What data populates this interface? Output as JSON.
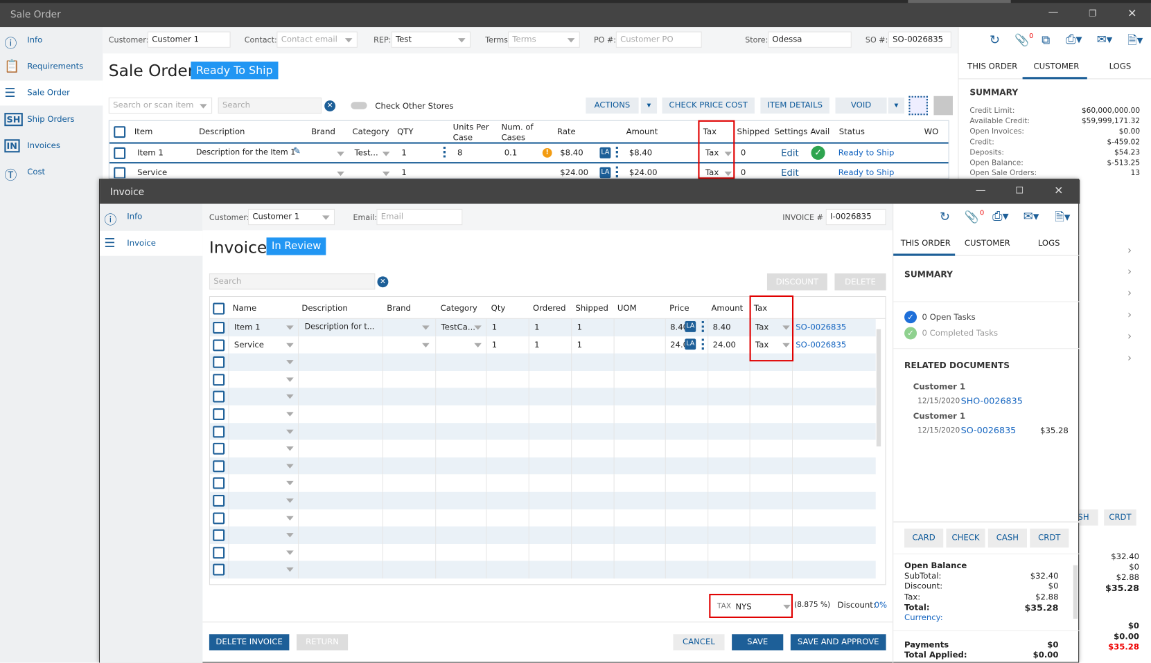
{
  "sale_order": {
    "window_title": "Sale Order",
    "sidebar": [
      {
        "label": "Info",
        "icon": "info-icon"
      },
      {
        "label": "Requirements",
        "icon": "clipboard-icon"
      },
      {
        "label": "Sale Order",
        "icon": "list-icon"
      },
      {
        "label": "Ship Orders",
        "icon": "ship-orders-icon"
      },
      {
        "label": "Invoices",
        "icon": "invoice-icon"
      },
      {
        "label": "Cost",
        "icon": "dollar-icon"
      }
    ],
    "header": {
      "customer_label": "Customer:",
      "customer": "Customer 1",
      "contact_label": "Contact:",
      "contact_placeholder": "Contact email",
      "rep_label": "REP:",
      "rep": "Test",
      "terms_label": "Terms:",
      "terms_placeholder": "Terms",
      "po_label": "PO #:",
      "po_placeholder": "Customer PO",
      "store_label": "Store:",
      "store": "Odessa",
      "so_label": "SO #:",
      "so": "SO-0026835"
    },
    "title": "Sale Order",
    "status": "Ready To Ship",
    "toolbar": {
      "search_item_placeholder": "Search or scan item",
      "search_placeholder": "Search",
      "check_other_stores": "Check Other Stores",
      "actions": "ACTIONS",
      "check_price_cost": "CHECK PRICE COST",
      "item_details": "ITEM DETAILS",
      "void": "VOID"
    },
    "columns": [
      "Item",
      "Description",
      "Brand",
      "Category",
      "QTY",
      "Units Per Case",
      "Num. of Cases",
      "Rate",
      "Amount",
      "Tax",
      "Shipped",
      "Settings",
      "Avail",
      "Status",
      "WO"
    ],
    "rows": [
      {
        "item": "Item 1",
        "description": "Description for the Item 1",
        "category": "Test...",
        "qty": "1",
        "units": "8",
        "cases": "0.1",
        "rate": "$8.40",
        "la": "LA",
        "amount": "$8.40",
        "tax": "Tax",
        "shipped": "0",
        "settings": "Edit",
        "status": "Ready to Ship"
      },
      {
        "item": "Service",
        "description": "",
        "category": "",
        "qty": "1",
        "units": "",
        "cases": "",
        "rate": "$24.00",
        "la": "LA",
        "amount": "$24.00",
        "tax": "Tax",
        "shipped": "0",
        "settings": "Edit",
        "status": "Ready to Ship"
      }
    ],
    "right": {
      "attach_count": "0",
      "tabs": [
        "THIS ORDER",
        "CUSTOMER",
        "LOGS"
      ],
      "summary_title": "SUMMARY",
      "summary": [
        {
          "k": "Credit Limit:",
          "v": "$60,000,000.00"
        },
        {
          "k": "Available Credit:",
          "v": "$59,999,171.32"
        },
        {
          "k": "Open Invoices:",
          "v": "$0.00"
        },
        {
          "k": "Credit:",
          "v": "$-459.02"
        },
        {
          "k": "Deposits:",
          "v": "$54.23"
        },
        {
          "k": "Open Balance:",
          "v": "$-513.25"
        },
        {
          "k": "Open Sale Orders:",
          "v": "13"
        }
      ],
      "pay_partial": [
        "SH",
        "CRDT"
      ],
      "balance_values": [
        "$32.40",
        "$0",
        "$2.88",
        "$35.28"
      ],
      "payment_values": [
        "$0",
        "$0.00",
        "$35.28"
      ]
    }
  },
  "invoice": {
    "window_title": "Invoice",
    "sidebar": [
      {
        "label": "Info"
      },
      {
        "label": "Invoice"
      }
    ],
    "header": {
      "customer_label": "Customer:",
      "customer": "Customer 1",
      "email_label": "Email:",
      "email_placeholder": "Email",
      "invoice_label": "INVOICE #",
      "invoice": "I-0026835"
    },
    "title": "Invoice",
    "status": "In Review",
    "search_placeholder": "Search",
    "discount_btn": "DISCOUNT",
    "delete_btn": "DELETE",
    "columns": [
      "Name",
      "Description",
      "Brand",
      "Category",
      "Qty",
      "Ordered",
      "Shipped",
      "UOM",
      "Price",
      "Amount",
      "Tax"
    ],
    "rows": [
      {
        "name": "Item 1",
        "description": "Description for t...",
        "category": "TestCa...",
        "qty": "1",
        "ordered": "1",
        "shipped": "1",
        "price": "8.40",
        "la": "LA",
        "amount": "8.40",
        "tax": "Tax",
        "so": "SO-0026835"
      },
      {
        "name": "Service",
        "description": "",
        "category": "",
        "qty": "1",
        "ordered": "1",
        "shipped": "1",
        "price": "24.00",
        "la": "LA",
        "amount": "24.00",
        "tax": "Tax",
        "so": "SO-0026835"
      }
    ],
    "empty_rows": 13,
    "footer": {
      "tax_label": "TAX",
      "tax_value": "NYS",
      "tax_rate": "(8.875 %)",
      "discount_label": "Discount:",
      "discount_value": "0%",
      "delete_invoice": "DELETE INVOICE",
      "return": "RETURN",
      "cancel": "CANCEL",
      "save": "SAVE",
      "save_approve": "SAVE AND APPROVE"
    },
    "right": {
      "attach_count": "0",
      "tabs": [
        "THIS ORDER",
        "CUSTOMER",
        "LOGS"
      ],
      "summary_title": "SUMMARY",
      "open_tasks": "0 Open Tasks",
      "completed_tasks": "0 Completed Tasks",
      "related_title": "RELATED DOCUMENTS",
      "related": [
        {
          "customer": "Customer 1",
          "date": "12/15/2020",
          "doc": "SHO-0026835",
          "amount": ""
        },
        {
          "customer": "Customer 1",
          "date": "12/15/2020",
          "doc": "SO-0026835",
          "amount": "$35.28"
        }
      ],
      "pay_buttons": [
        "CARD",
        "CHECK",
        "CASH",
        "CRDT"
      ],
      "open_balance_title": "Open Balance",
      "balance": [
        {
          "k": "SubTotal:",
          "v": "$32.40"
        },
        {
          "k": "Discount:",
          "v": "$0"
        },
        {
          "k": "Tax:",
          "v": "$2.88"
        },
        {
          "k": "Total:",
          "v": "$35.28"
        }
      ],
      "currency": "Currency:",
      "payments": [
        {
          "k": "Payments",
          "v": "$0"
        },
        {
          "k": "Total Applied:",
          "v": "$0.00"
        }
      ]
    }
  }
}
